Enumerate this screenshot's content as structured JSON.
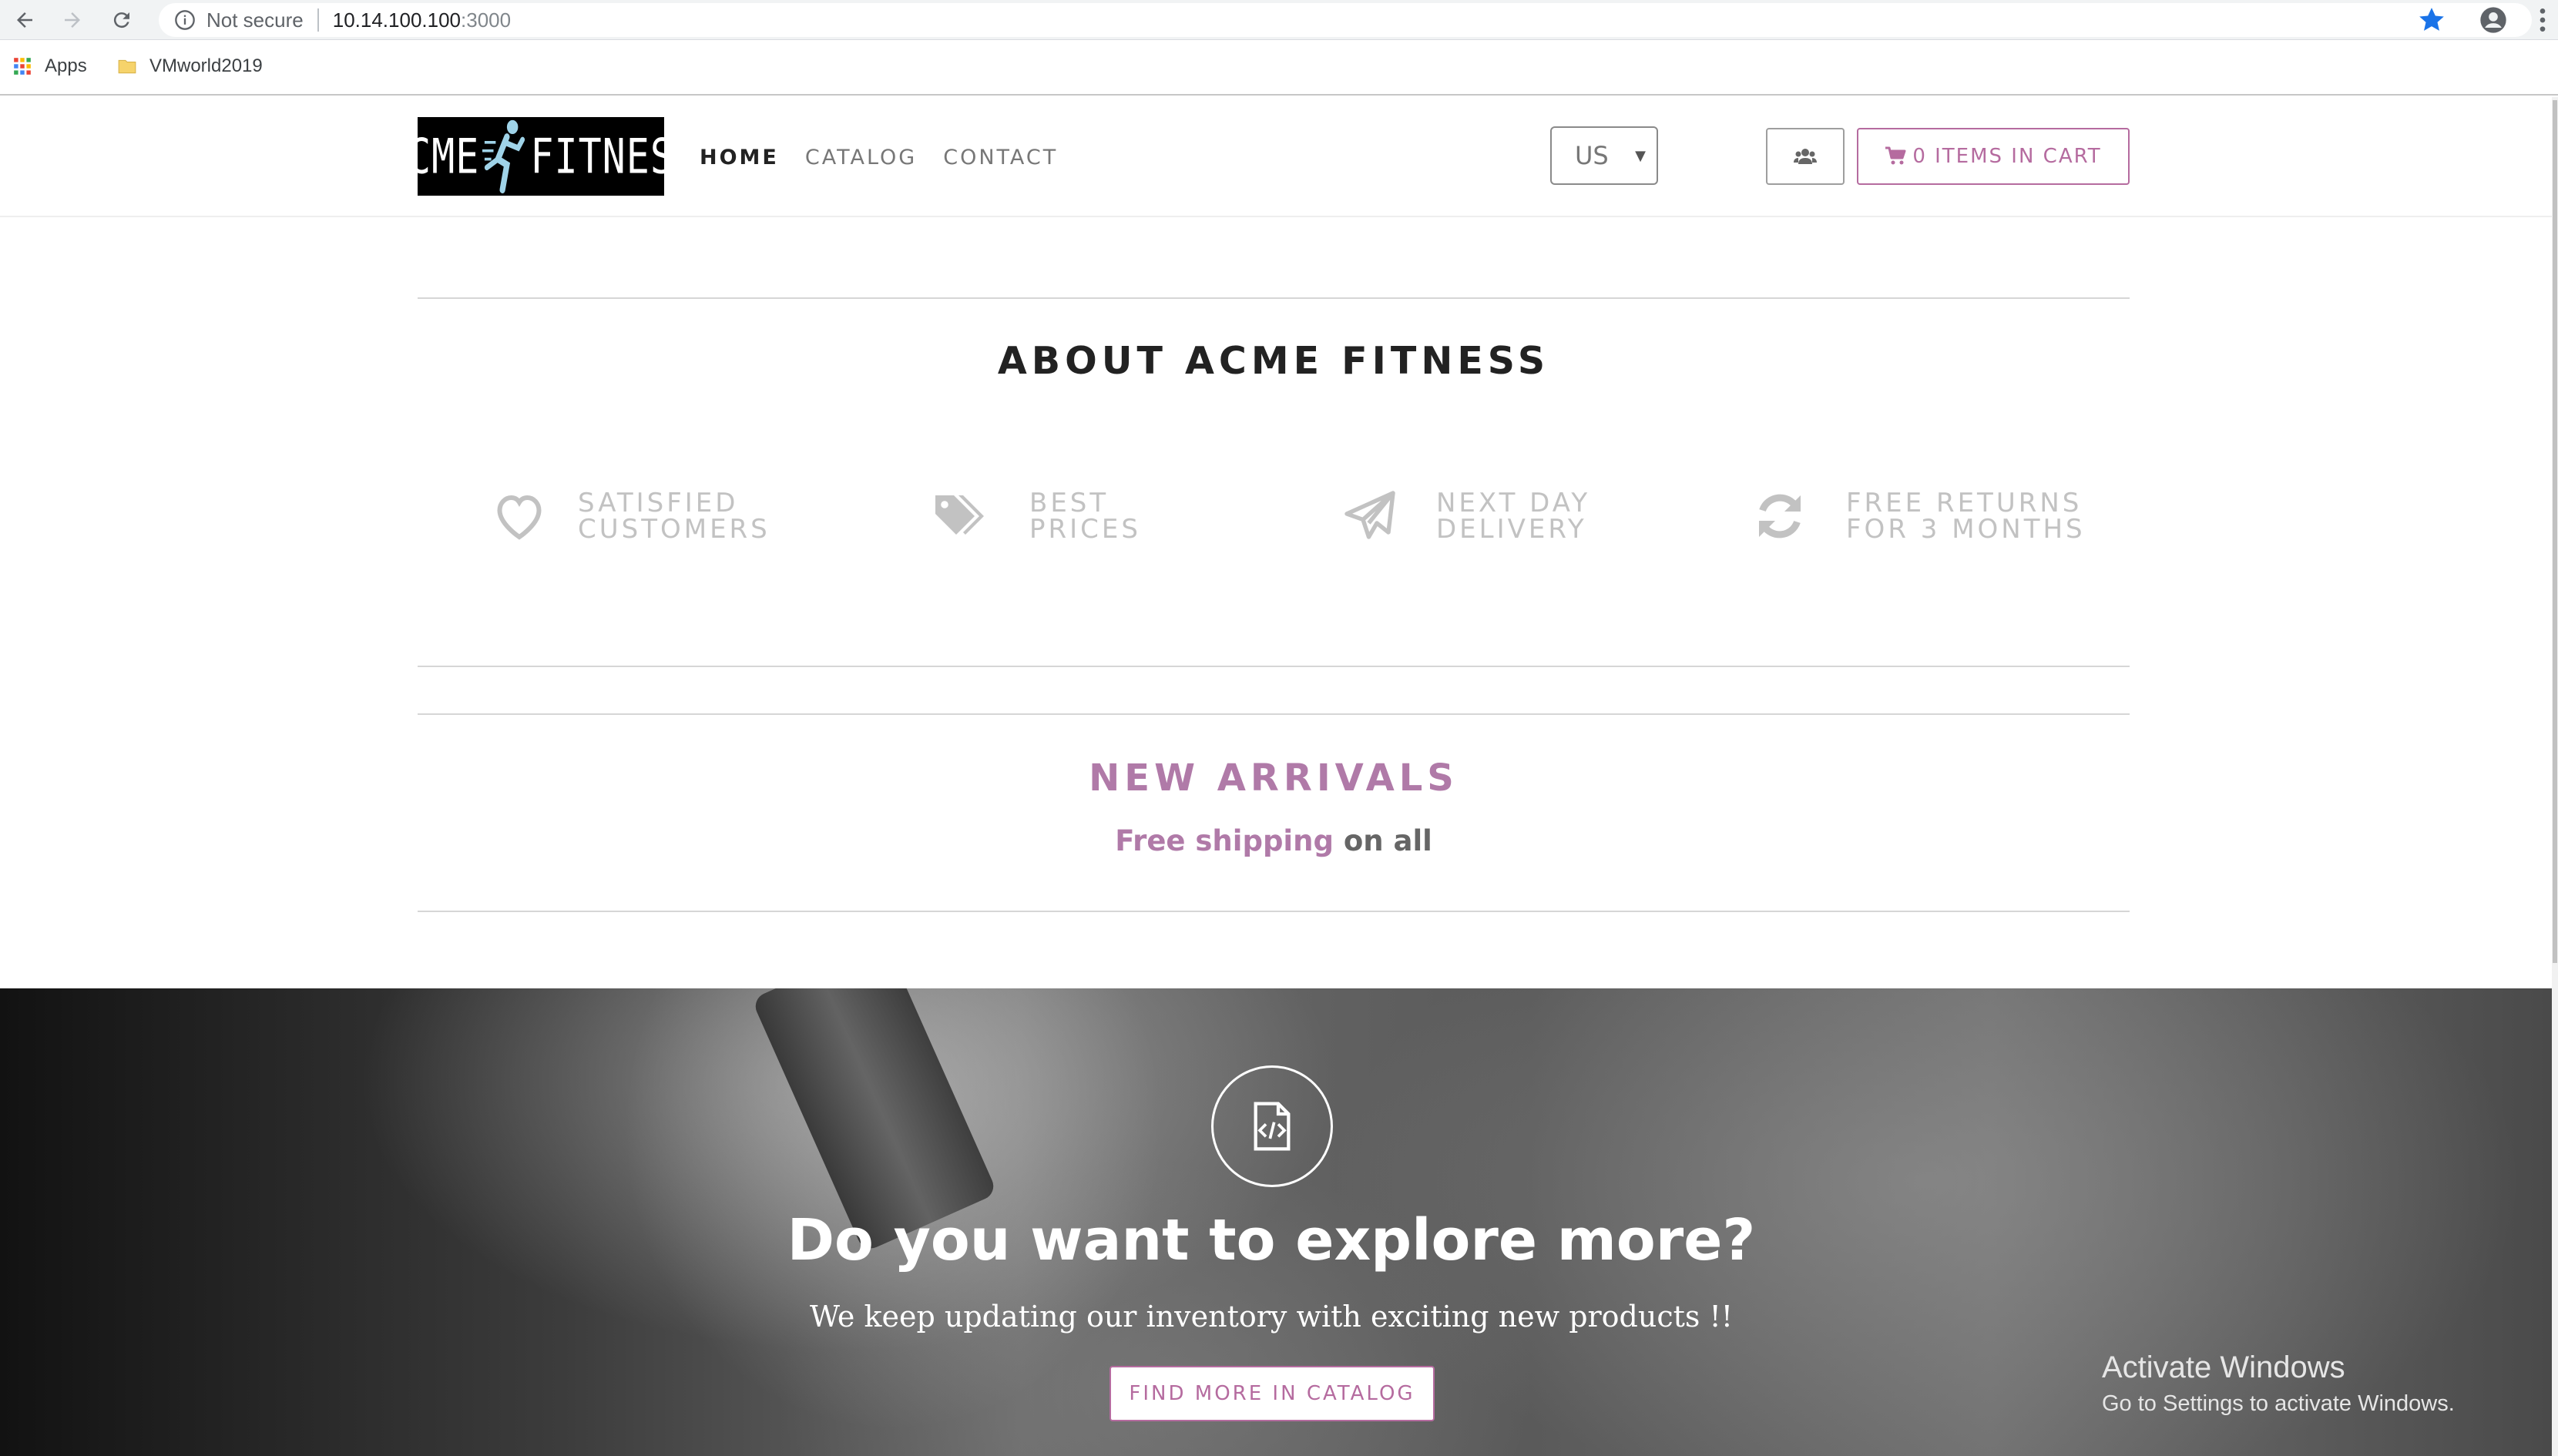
{
  "browser": {
    "security": "Not secure",
    "url_host": "10.14.100.100",
    "url_port": ":3000",
    "bookmarks": [
      {
        "label": "Apps"
      },
      {
        "label": "VMworld2019"
      }
    ]
  },
  "header": {
    "logo_left": "ACME",
    "logo_right": "FITNESS",
    "nav": [
      {
        "label": "HOME"
      },
      {
        "label": "CATALOG"
      },
      {
        "label": "CONTACT"
      }
    ],
    "country": "US",
    "cart_label": "0 ITEMS IN CART"
  },
  "about": {
    "title": "ABOUT ACME FITNESS",
    "features": [
      {
        "line1": "SATISFIED",
        "line2": "CUSTOMERS",
        "icon": "heart-icon"
      },
      {
        "line1": "BEST",
        "line2": "PRICES",
        "icon": "tags-icon"
      },
      {
        "line1": "NEXT DAY",
        "line2": "DELIVERY",
        "icon": "paper-plane-icon"
      },
      {
        "line1": "FREE RETURNS",
        "line2": "FOR 3 MONTHS",
        "icon": "refresh-icon"
      }
    ]
  },
  "arrivals": {
    "title": "NEW ARRIVALS",
    "sub_highlight": "Free shipping",
    "sub_rest": " on all"
  },
  "hero": {
    "title": "Do you want to explore more?",
    "subtitle": "We keep updating our inventory with exciting new products !!",
    "button": "FIND MORE IN CATALOG"
  },
  "watermark": {
    "line1": "Activate Windows",
    "line2": "Go to Settings to activate Windows."
  },
  "colors": {
    "accent": "#b56b9f",
    "accent_text": "#b07aa8"
  }
}
